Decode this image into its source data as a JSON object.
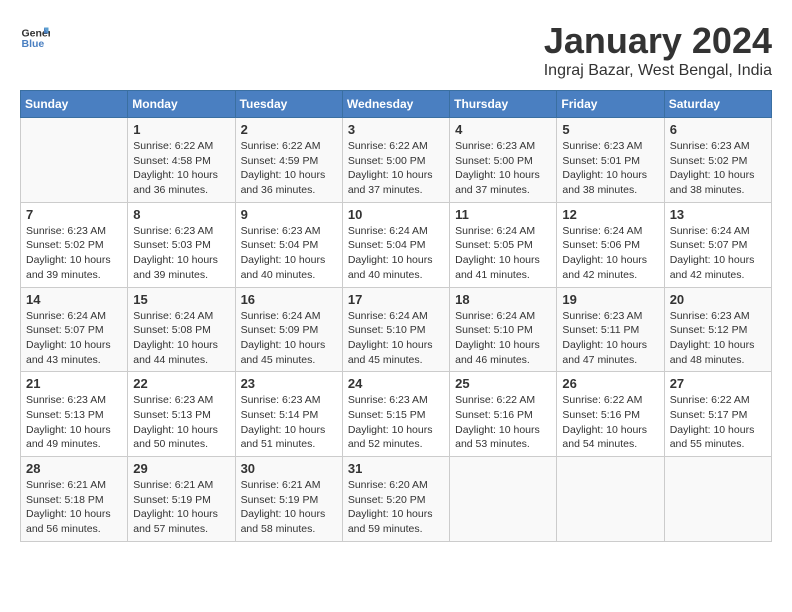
{
  "logo": {
    "text_general": "General",
    "text_blue": "Blue"
  },
  "title": "January 2024",
  "subtitle": "Ingraj Bazar, West Bengal, India",
  "days_of_week": [
    "Sunday",
    "Monday",
    "Tuesday",
    "Wednesday",
    "Thursday",
    "Friday",
    "Saturday"
  ],
  "weeks": [
    [
      {
        "day": "",
        "content": ""
      },
      {
        "day": "1",
        "content": "Sunrise: 6:22 AM\nSunset: 4:58 PM\nDaylight: 10 hours\nand 36 minutes."
      },
      {
        "day": "2",
        "content": "Sunrise: 6:22 AM\nSunset: 4:59 PM\nDaylight: 10 hours\nand 36 minutes."
      },
      {
        "day": "3",
        "content": "Sunrise: 6:22 AM\nSunset: 5:00 PM\nDaylight: 10 hours\nand 37 minutes."
      },
      {
        "day": "4",
        "content": "Sunrise: 6:23 AM\nSunset: 5:00 PM\nDaylight: 10 hours\nand 37 minutes."
      },
      {
        "day": "5",
        "content": "Sunrise: 6:23 AM\nSunset: 5:01 PM\nDaylight: 10 hours\nand 38 minutes."
      },
      {
        "day": "6",
        "content": "Sunrise: 6:23 AM\nSunset: 5:02 PM\nDaylight: 10 hours\nand 38 minutes."
      }
    ],
    [
      {
        "day": "7",
        "content": "Sunrise: 6:23 AM\nSunset: 5:02 PM\nDaylight: 10 hours\nand 39 minutes."
      },
      {
        "day": "8",
        "content": "Sunrise: 6:23 AM\nSunset: 5:03 PM\nDaylight: 10 hours\nand 39 minutes."
      },
      {
        "day": "9",
        "content": "Sunrise: 6:23 AM\nSunset: 5:04 PM\nDaylight: 10 hours\nand 40 minutes."
      },
      {
        "day": "10",
        "content": "Sunrise: 6:24 AM\nSunset: 5:04 PM\nDaylight: 10 hours\nand 40 minutes."
      },
      {
        "day": "11",
        "content": "Sunrise: 6:24 AM\nSunset: 5:05 PM\nDaylight: 10 hours\nand 41 minutes."
      },
      {
        "day": "12",
        "content": "Sunrise: 6:24 AM\nSunset: 5:06 PM\nDaylight: 10 hours\nand 42 minutes."
      },
      {
        "day": "13",
        "content": "Sunrise: 6:24 AM\nSunset: 5:07 PM\nDaylight: 10 hours\nand 42 minutes."
      }
    ],
    [
      {
        "day": "14",
        "content": "Sunrise: 6:24 AM\nSunset: 5:07 PM\nDaylight: 10 hours\nand 43 minutes."
      },
      {
        "day": "15",
        "content": "Sunrise: 6:24 AM\nSunset: 5:08 PM\nDaylight: 10 hours\nand 44 minutes."
      },
      {
        "day": "16",
        "content": "Sunrise: 6:24 AM\nSunset: 5:09 PM\nDaylight: 10 hours\nand 45 minutes."
      },
      {
        "day": "17",
        "content": "Sunrise: 6:24 AM\nSunset: 5:10 PM\nDaylight: 10 hours\nand 45 minutes."
      },
      {
        "day": "18",
        "content": "Sunrise: 6:24 AM\nSunset: 5:10 PM\nDaylight: 10 hours\nand 46 minutes."
      },
      {
        "day": "19",
        "content": "Sunrise: 6:23 AM\nSunset: 5:11 PM\nDaylight: 10 hours\nand 47 minutes."
      },
      {
        "day": "20",
        "content": "Sunrise: 6:23 AM\nSunset: 5:12 PM\nDaylight: 10 hours\nand 48 minutes."
      }
    ],
    [
      {
        "day": "21",
        "content": "Sunrise: 6:23 AM\nSunset: 5:13 PM\nDaylight: 10 hours\nand 49 minutes."
      },
      {
        "day": "22",
        "content": "Sunrise: 6:23 AM\nSunset: 5:13 PM\nDaylight: 10 hours\nand 50 minutes."
      },
      {
        "day": "23",
        "content": "Sunrise: 6:23 AM\nSunset: 5:14 PM\nDaylight: 10 hours\nand 51 minutes."
      },
      {
        "day": "24",
        "content": "Sunrise: 6:23 AM\nSunset: 5:15 PM\nDaylight: 10 hours\nand 52 minutes."
      },
      {
        "day": "25",
        "content": "Sunrise: 6:22 AM\nSunset: 5:16 PM\nDaylight: 10 hours\nand 53 minutes."
      },
      {
        "day": "26",
        "content": "Sunrise: 6:22 AM\nSunset: 5:16 PM\nDaylight: 10 hours\nand 54 minutes."
      },
      {
        "day": "27",
        "content": "Sunrise: 6:22 AM\nSunset: 5:17 PM\nDaylight: 10 hours\nand 55 minutes."
      }
    ],
    [
      {
        "day": "28",
        "content": "Sunrise: 6:21 AM\nSunset: 5:18 PM\nDaylight: 10 hours\nand 56 minutes."
      },
      {
        "day": "29",
        "content": "Sunrise: 6:21 AM\nSunset: 5:19 PM\nDaylight: 10 hours\nand 57 minutes."
      },
      {
        "day": "30",
        "content": "Sunrise: 6:21 AM\nSunset: 5:19 PM\nDaylight: 10 hours\nand 58 minutes."
      },
      {
        "day": "31",
        "content": "Sunrise: 6:20 AM\nSunset: 5:20 PM\nDaylight: 10 hours\nand 59 minutes."
      },
      {
        "day": "",
        "content": ""
      },
      {
        "day": "",
        "content": ""
      },
      {
        "day": "",
        "content": ""
      }
    ]
  ]
}
